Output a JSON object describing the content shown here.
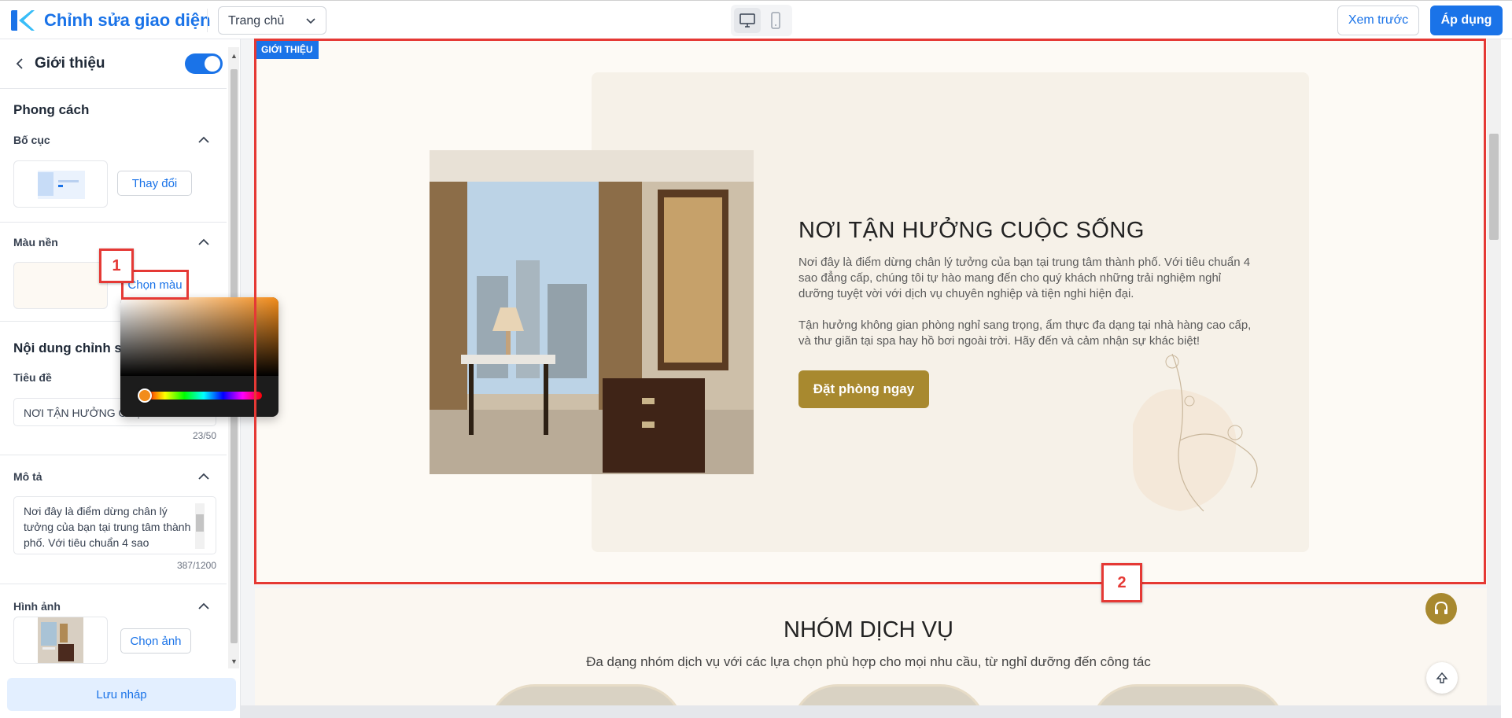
{
  "header": {
    "app_title": "Chỉnh sửa giao diện",
    "page_selector": "Trang chủ",
    "preview_label": "Xem trước",
    "apply_label": "Áp dụng"
  },
  "sidebar": {
    "section_title": "Giới thiệu",
    "style_heading": "Phong cách",
    "layout_label": "Bố cục",
    "layout_change_label": "Thay đổi",
    "background_label": "Màu nền",
    "choose_color_label": "Chọn màu",
    "content_heading": "Nội dung chỉnh sửa",
    "title_label": "Tiêu đề",
    "title_value": "NƠI TẬN HƯỞNG CUỘC SỐNG",
    "title_counter": "23/50",
    "description_label": "Mô tả",
    "description_value": "Nơi đây là điểm dừng chân lý tưởng của bạn tại trung tâm thành phố. Với tiêu chuẩn 4 sao",
    "description_counter": "387/1200",
    "image_label": "Hình ảnh",
    "choose_image_label": "Chọn ảnh",
    "save_draft_label": "Lưu nháp"
  },
  "annotations": {
    "marker_1": "1",
    "marker_2": "2",
    "color": "#e53935"
  },
  "preview": {
    "section_tag": "GIỚI THIỆU",
    "intro_title": "NƠI TẬN HƯỞNG CUỘC SỐNG",
    "intro_paragraph_1": "Nơi đây là điểm dừng chân lý tưởng của bạn tại trung tâm thành phố. Với tiêu chuẩn 4 sao đẳng cấp, chúng tôi tự hào mang đến cho quý khách những trải nghiệm nghỉ dưỡng tuyệt vời với dịch vụ chuyên nghiệp và tiện nghi hiện đại.",
    "intro_paragraph_2": "Tận hưởng không gian phòng nghỉ sang trọng, ẩm thực đa dạng tại nhà hàng cao cấp, và thư giãn tại spa hay hồ bơi ngoài trời. Hãy đến và cảm nhận sự khác biệt!",
    "book_button_label": "Đặt phòng ngay",
    "services_title": "NHÓM DỊCH VỤ",
    "services_subtitle": "Đa dạng nhóm dịch vụ với các lựa chọn phù hợp cho mọi nhu cầu, từ nghỉ dưỡng đến công tác"
  },
  "colors": {
    "brand_blue": "#1a73e8",
    "accent_gold": "#a8892f",
    "picker_orange": "#f28c1b"
  }
}
